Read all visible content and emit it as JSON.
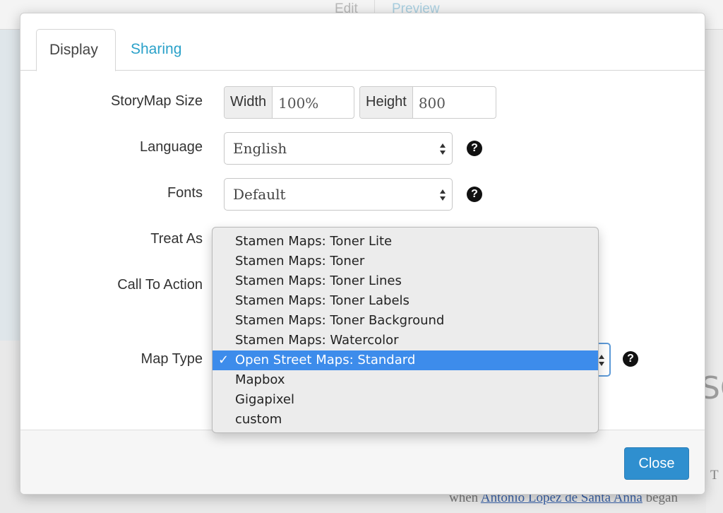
{
  "background": {
    "tabs": [
      "Edit",
      "Preview"
    ],
    "partial_heading": "SC",
    "partial_text_top": "T",
    "text_prefix": "when ",
    "text_link": "Antonio Lopez de Santa Anna",
    "text_suffix": " began"
  },
  "modal": {
    "tabs": [
      {
        "label": "Display",
        "active": true
      },
      {
        "label": "Sharing",
        "active": false
      }
    ],
    "size": {
      "label": "StoryMap Size",
      "width_label": "Width",
      "width_value": "100%",
      "height_label": "Height",
      "height_value": "800"
    },
    "language": {
      "label": "Language",
      "value": "English"
    },
    "fonts": {
      "label": "Fonts",
      "value": "Default"
    },
    "treat_as": {
      "label": "Treat As"
    },
    "call_to_action": {
      "label": "Call To Action"
    },
    "map_type": {
      "label": "Map Type",
      "options": [
        "Stamen Maps: Toner Lite",
        "Stamen Maps: Toner",
        "Stamen Maps: Toner Lines",
        "Stamen Maps: Toner Labels",
        "Stamen Maps: Toner Background",
        "Stamen Maps: Watercolor",
        "Open Street Maps: Standard",
        "Mapbox",
        "Gigapixel",
        "custom"
      ],
      "selected_index": 6,
      "check_mark": "✓"
    },
    "help_glyph": "?",
    "close_label": "Close"
  },
  "colors": {
    "accent": "#2aa1c9",
    "button": "#2f8fcf",
    "selection": "#3d8ceb"
  }
}
